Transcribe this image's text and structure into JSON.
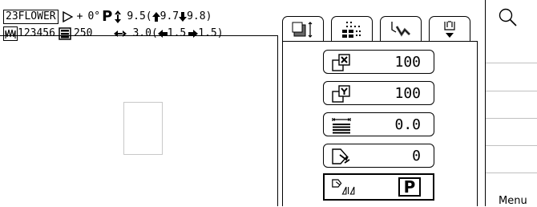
{
  "status": {
    "pattern_no": "23",
    "pattern_name": "FLOWER",
    "feed_sign": "+",
    "angle": "0°",
    "angle_icon": "feed-angle-icon",
    "p_mark": "P",
    "height_icon": "vertical-arrows-icon",
    "height": "9.5",
    "height_up": "9.7",
    "height_down": "9.8",
    "file_no": "123456",
    "stitch_icon": "zigzag-stitch-icon",
    "stitch_count_icon": "stitch-list-icon",
    "stitch_count": "250",
    "width_icon": "horizontal-arrows-icon",
    "width": "3.0",
    "width_left": "1.5",
    "width_right": "1.5",
    "open_paren": "(",
    "close_paren": ")"
  },
  "tabs": [
    {
      "name": "tab-scale",
      "icon": "scale-frame-icon"
    },
    {
      "name": "tab-grid",
      "icon": "dot-grid-icon"
    },
    {
      "name": "tab-needle",
      "icon": "needle-icon"
    },
    {
      "name": "tab-bell",
      "icon": "bell-pattern-icon"
    }
  ],
  "params": [
    {
      "name": "x-scale",
      "icon": "x-scale-icon",
      "value": "100"
    },
    {
      "name": "y-scale",
      "icon": "y-scale-icon",
      "value": "100"
    },
    {
      "name": "density",
      "icon": "density-icon",
      "value": "0.0"
    },
    {
      "name": "rotate",
      "icon": "rotate-icon",
      "value": "0"
    }
  ],
  "mirror": {
    "icon": "mirror-icon",
    "label": "P"
  },
  "right_column": {
    "search_icon": "magnifier-icon",
    "menu_label": "Menu"
  }
}
